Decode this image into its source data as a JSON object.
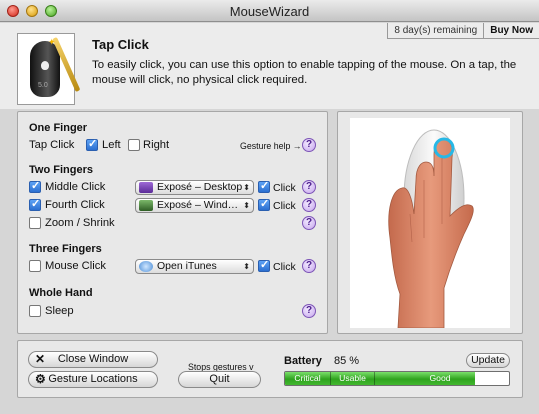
{
  "window": {
    "title": "MouseWizard",
    "trial_remaining": "8 day(s) remaining",
    "buy_now_label": "Buy Now"
  },
  "header": {
    "title": "Tap Click",
    "description": "To easily click, you can use this option to enable tapping of the mouse. On a tap, the mouse will click, no physical click required.",
    "icon_version": "5.0"
  },
  "one_finger": {
    "section_label": "One Finger",
    "tap_click_label": "Tap Click",
    "left": {
      "label": "Left",
      "checked": true
    },
    "right": {
      "label": "Right",
      "checked": false
    },
    "gesture_help_label": "Gesture help →",
    "help_glyph": "?"
  },
  "two_fingers": {
    "section_label": "Two Fingers",
    "middle_click": {
      "label": "Middle Click",
      "checked": true,
      "action": "Exposé – Desktop",
      "click_label": "Click",
      "click_checked": true
    },
    "fourth_click": {
      "label": "Fourth Click",
      "checked": true,
      "action": "Exposé – Wind…",
      "click_label": "Click",
      "click_checked": true
    },
    "zoom_shrink": {
      "label": "Zoom / Shrink",
      "checked": false
    }
  },
  "three_fingers": {
    "section_label": "Three Fingers",
    "mouse_click": {
      "label": "Mouse Click",
      "checked": false,
      "action": "Open iTunes",
      "click_label": "Click",
      "click_checked": true
    }
  },
  "whole_hand": {
    "section_label": "Whole Hand",
    "sleep": {
      "label": "Sleep",
      "checked": false
    }
  },
  "bottom": {
    "close_window_label": "Close Window",
    "gesture_locations_label": "Gesture Locations",
    "stops_gestures_label": "Stops gestures v",
    "quit_label": "Quit",
    "battery_label": "Battery",
    "battery_percent": "85 %",
    "battery_level": 0.85,
    "update_label": "Update",
    "zones": [
      "Critical",
      "Usable",
      "Good"
    ]
  },
  "colors": {
    "checkbox_checked": "#2b6fd0",
    "help_purple": "#7d55b6",
    "battery_green": "#2fa31e"
  },
  "icons": {
    "close": "close-x-icon",
    "gesture_locations": "gear-icon",
    "popup_expose": "expose-icon",
    "popup_itunes": "itunes-note-icon"
  }
}
